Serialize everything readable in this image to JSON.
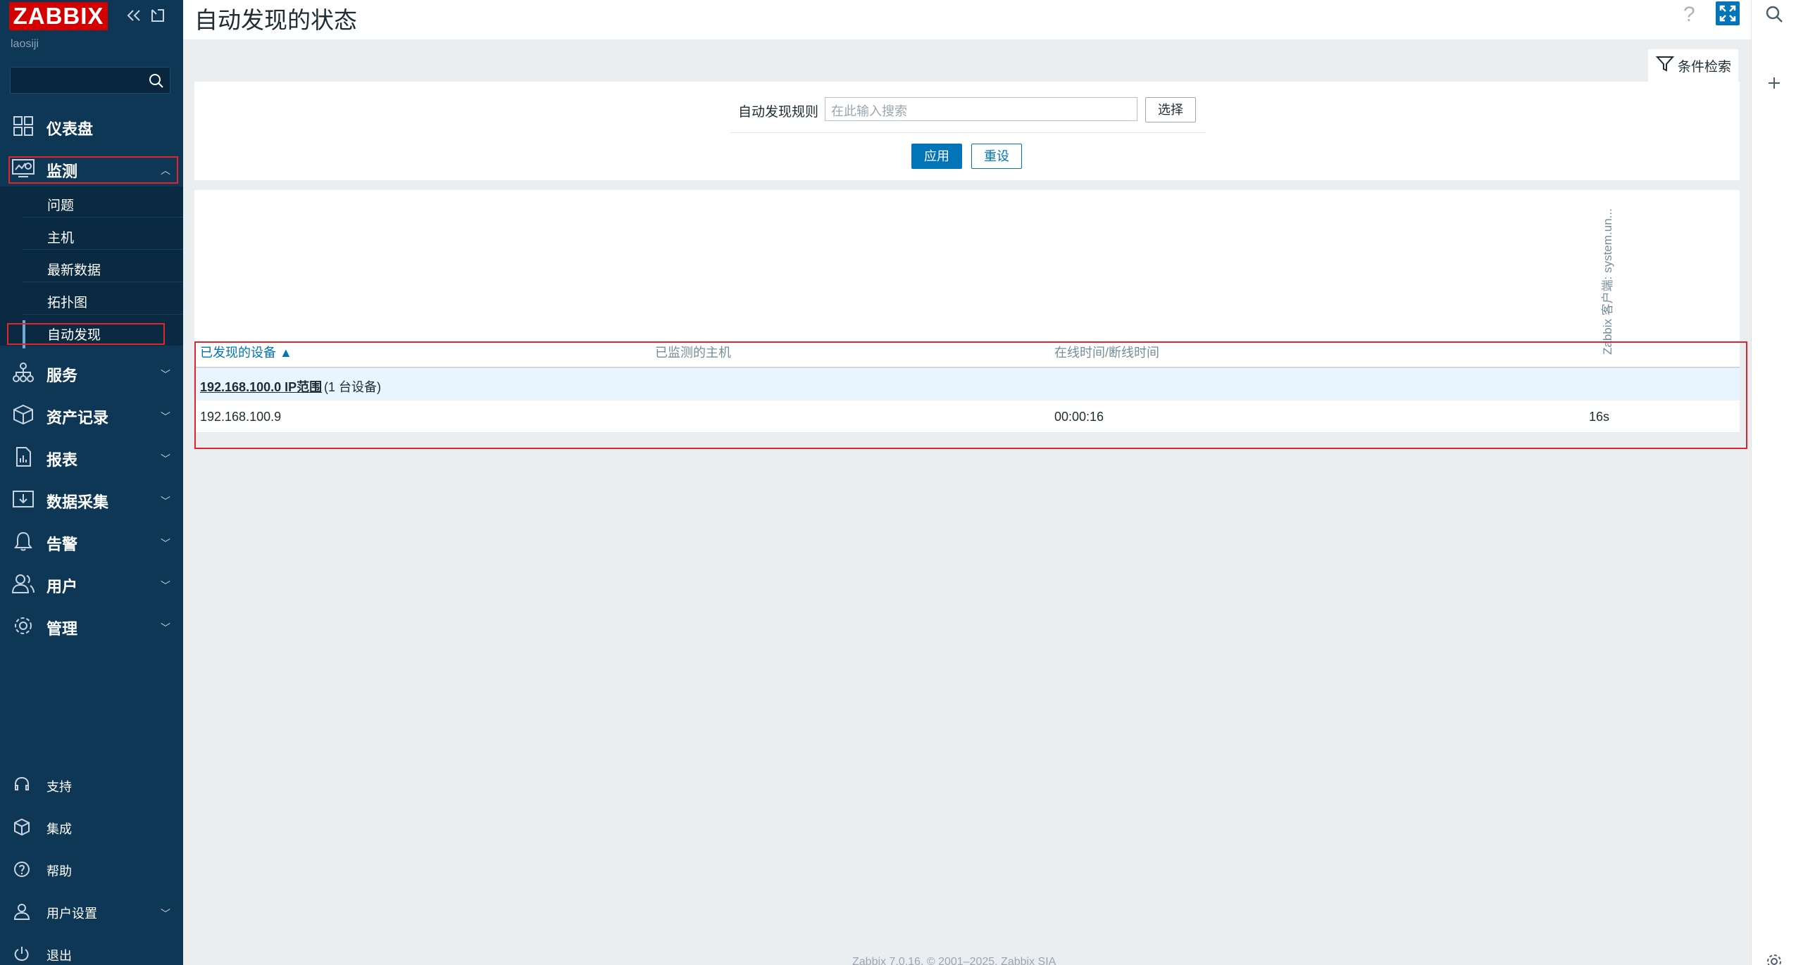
{
  "sidebar": {
    "logo": "ZABBIX",
    "server_name": "laosiji",
    "menu": [
      {
        "label": "仪表盘",
        "icon": "dashboard-icon"
      },
      {
        "label": "监测",
        "icon": "monitoring-icon"
      },
      {
        "label": "服务",
        "icon": "services-icon"
      },
      {
        "label": "资产记录",
        "icon": "inventory-icon"
      },
      {
        "label": "报表",
        "icon": "reports-icon"
      },
      {
        "label": "数据采集",
        "icon": "data-collection-icon"
      },
      {
        "label": "告警",
        "icon": "alerts-icon"
      },
      {
        "label": "用户",
        "icon": "users-icon"
      },
      {
        "label": "管理",
        "icon": "administration-icon"
      }
    ],
    "submenu": [
      {
        "label": "问题"
      },
      {
        "label": "主机"
      },
      {
        "label": "最新数据"
      },
      {
        "label": "拓扑图"
      },
      {
        "label": "自动发现"
      }
    ],
    "bottom": [
      {
        "label": "支持",
        "icon": "support-icon"
      },
      {
        "label": "集成",
        "icon": "integrations-icon"
      },
      {
        "label": "帮助",
        "icon": "help-icon"
      },
      {
        "label": "用户设置",
        "icon": "user-settings-icon"
      },
      {
        "label": "退出",
        "icon": "sign-out-icon"
      }
    ]
  },
  "header": {
    "title": "自动发现的状态",
    "help": "?"
  },
  "filter": {
    "tab_label": "条件检索",
    "rule_label": "自动发现规则",
    "rule_placeholder": "在此输入搜索",
    "select_button": "选择",
    "apply_button": "应用",
    "reset_button": "重设"
  },
  "table": {
    "headers": {
      "discovered_device": "已发现的设备 ▲",
      "monitored_host": "已监测的主机",
      "uptime_downtime": "在线时间/断线时间",
      "check_column": "Zabbix 客户端: system.un..."
    },
    "group": {
      "range": "192.168.100.0 IP范围",
      "count": "(1 台设备)"
    },
    "rows": [
      {
        "device": "192.168.100.9",
        "host": "",
        "uptime": "00:00:16",
        "check": "16s"
      }
    ]
  },
  "footer": "Zabbix 7.0.16. © 2001–2025, Zabbix SIA",
  "colors": {
    "sidebar_bg": "#0e3755",
    "accent": "#0275b8",
    "logo_red": "#d40000",
    "highlight_border": "#e0262b"
  }
}
